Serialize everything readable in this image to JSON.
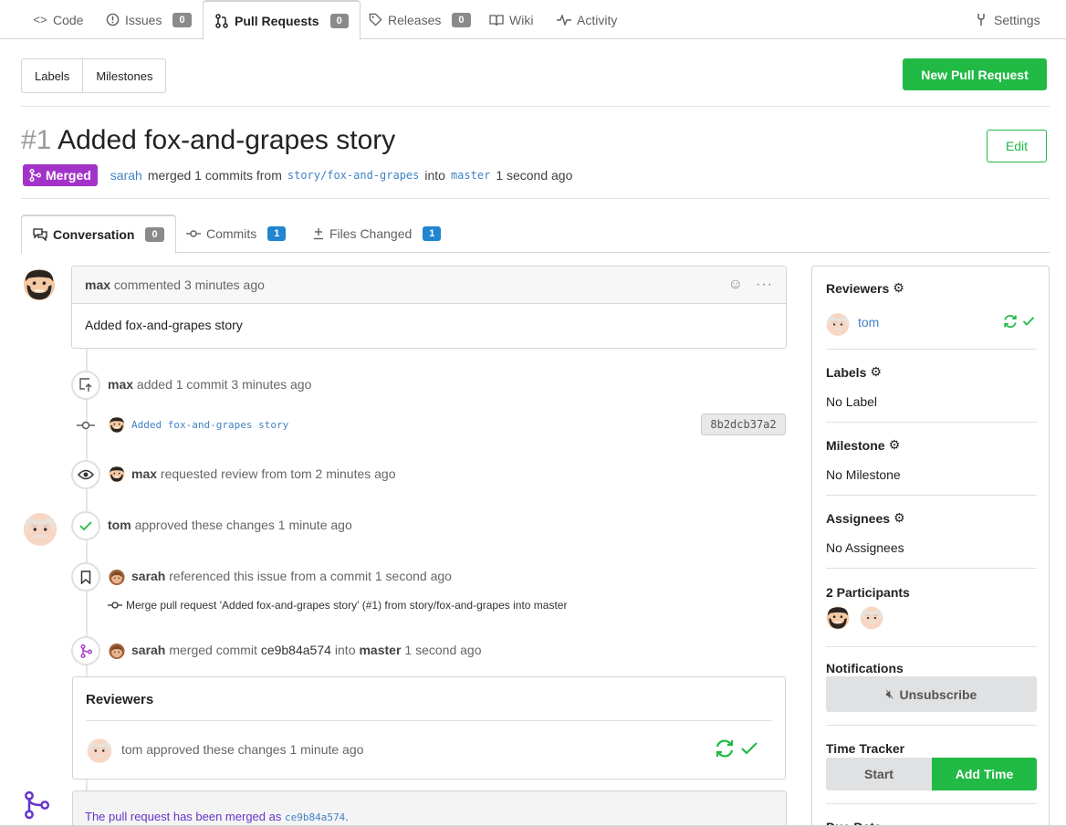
{
  "nav": {
    "tabs": [
      {
        "label": "Code",
        "icon": "code-icon"
      },
      {
        "label": "Issues",
        "icon": "issue-icon",
        "count": "0"
      },
      {
        "label": "Pull Requests",
        "icon": "pull-request-icon",
        "count": "0",
        "active": true
      },
      {
        "label": "Releases",
        "icon": "tag-icon",
        "count": "0"
      },
      {
        "label": "Wiki",
        "icon": "book-icon"
      },
      {
        "label": "Activity",
        "icon": "pulse-icon"
      }
    ],
    "settings": "Settings"
  },
  "toolbar": {
    "labels": "Labels",
    "milestones": "Milestones",
    "new_pr": "New Pull Request"
  },
  "pr": {
    "number": "#1",
    "title": "Added fox-and-grapes story",
    "edit": "Edit",
    "status": "Merged",
    "author": "sarah",
    "merged_text": "merged 1 commits from",
    "head_branch": "story/fox-and-grapes",
    "into": "into",
    "base_branch": "master",
    "when": "1 second ago"
  },
  "subtabs": [
    {
      "label": "Conversation",
      "count": "0"
    },
    {
      "label": "Commits",
      "count": "1"
    },
    {
      "label": "Files Changed",
      "count": "1"
    }
  ],
  "timeline": {
    "comment": {
      "user": "max",
      "action": "commented 3 minutes ago",
      "body": "Added fox-and-grapes story"
    },
    "added_commit": {
      "user": "max",
      "text": "added 1 commit 3 minutes ago"
    },
    "commit": {
      "message": "Added fox-and-grapes story",
      "sha": "8b2dcb37a2"
    },
    "review_request": {
      "user": "max",
      "text": "requested review from tom 2 minutes ago"
    },
    "approval": {
      "user": "tom",
      "text": "approved these changes 1 minute ago"
    },
    "reference": {
      "user": "sarah",
      "text": "referenced this issue from a commit 1 second ago",
      "commit_msg": "Merge pull request 'Added fox-and-grapes story' (#1) from story/fox-and-grapes into master"
    },
    "merge": {
      "user": "sarah",
      "pre": "merged commit",
      "sha": "ce9b84a574",
      "into": "into",
      "branch": "master",
      "when": "1 second ago"
    },
    "reviewers_box": {
      "title": "Reviewers",
      "user": "tom",
      "text": "approved these changes 1 minute ago"
    },
    "merged_notice": {
      "text": "The pull request has been merged as",
      "sha": "ce9b84a574",
      "end": "."
    }
  },
  "sidebar": {
    "reviewers": {
      "title": "Reviewers",
      "user": "tom"
    },
    "labels": {
      "title": "Labels",
      "value": "No Label"
    },
    "milestone": {
      "title": "Milestone",
      "value": "No Milestone"
    },
    "assignees": {
      "title": "Assignees",
      "value": "No Assignees"
    },
    "participants": {
      "title": "2 Participants"
    },
    "notifications": {
      "title": "Notifications",
      "button": "Unsubscribe"
    },
    "time_tracker": {
      "title": "Time Tracker",
      "start": "Start",
      "add": "Add Time"
    },
    "due_date": {
      "title": "Due Date"
    }
  },
  "colors": {
    "green": "#21ba45",
    "purple": "#a333c8",
    "link": "#4183c4",
    "count_blue": "#2185d0"
  }
}
